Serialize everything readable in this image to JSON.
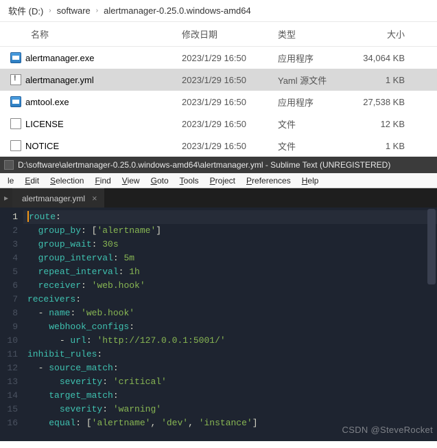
{
  "breadcrumb": [
    "软件 (D:)",
    "software",
    "alertmanager-0.25.0.windows-amd64"
  ],
  "columns": {
    "name": "名称",
    "date": "修改日期",
    "type": "类型",
    "size": "大小"
  },
  "files": [
    {
      "name": "alertmanager.exe",
      "date": "2023/1/29 16:50",
      "type": "应用程序",
      "size": "34,064 KB",
      "icon": "exe",
      "selected": false
    },
    {
      "name": "alertmanager.yml",
      "date": "2023/1/29 16:50",
      "type": "Yaml 源文件",
      "size": "1 KB",
      "icon": "yml",
      "selected": true
    },
    {
      "name": "amtool.exe",
      "date": "2023/1/29 16:50",
      "type": "应用程序",
      "size": "27,538 KB",
      "icon": "exe",
      "selected": false
    },
    {
      "name": "LICENSE",
      "date": "2023/1/29 16:50",
      "type": "文件",
      "size": "12 KB",
      "icon": "file",
      "selected": false
    },
    {
      "name": "NOTICE",
      "date": "2023/1/29 16:50",
      "type": "文件",
      "size": "1 KB",
      "icon": "file",
      "selected": false
    }
  ],
  "sublime": {
    "title": "D:\\software\\alertmanager-0.25.0.windows-amd64\\alertmanager.yml - Sublime Text (UNREGISTERED)",
    "menu": [
      "File",
      "Edit",
      "Selection",
      "Find",
      "View",
      "Goto",
      "Tools",
      "Project",
      "Preferences",
      "Help"
    ],
    "tab": "alertmanager.yml",
    "active_line": 1,
    "code": [
      [
        [
          "key",
          "route"
        ],
        [
          "punc",
          ":"
        ]
      ],
      [
        [
          "indent",
          "  "
        ],
        [
          "key",
          "group_by"
        ],
        [
          "punc",
          ": ["
        ],
        [
          "str",
          "'alertname'"
        ],
        [
          "punc",
          "]"
        ]
      ],
      [
        [
          "indent",
          "  "
        ],
        [
          "key",
          "group_wait"
        ],
        [
          "punc",
          ": "
        ],
        [
          "str",
          "30s"
        ]
      ],
      [
        [
          "indent",
          "  "
        ],
        [
          "key",
          "group_interval"
        ],
        [
          "punc",
          ": "
        ],
        [
          "str",
          "5m"
        ]
      ],
      [
        [
          "indent",
          "  "
        ],
        [
          "key",
          "repeat_interval"
        ],
        [
          "punc",
          ": "
        ],
        [
          "str",
          "1h"
        ]
      ],
      [
        [
          "indent",
          "  "
        ],
        [
          "key",
          "receiver"
        ],
        [
          "punc",
          ": "
        ],
        [
          "str",
          "'web.hook'"
        ]
      ],
      [
        [
          "key",
          "receivers"
        ],
        [
          "punc",
          ":"
        ]
      ],
      [
        [
          "indent",
          "  "
        ],
        [
          "dash",
          "- "
        ],
        [
          "key",
          "name"
        ],
        [
          "punc",
          ": "
        ],
        [
          "str",
          "'web.hook'"
        ]
      ],
      [
        [
          "indent",
          "    "
        ],
        [
          "key",
          "webhook_configs"
        ],
        [
          "punc",
          ":"
        ]
      ],
      [
        [
          "indent",
          "      "
        ],
        [
          "dash",
          "- "
        ],
        [
          "key",
          "url"
        ],
        [
          "punc",
          ": "
        ],
        [
          "str",
          "'http://127.0.0.1:5001/'"
        ]
      ],
      [
        [
          "key",
          "inhibit_rules"
        ],
        [
          "punc",
          ":"
        ]
      ],
      [
        [
          "indent",
          "  "
        ],
        [
          "dash",
          "- "
        ],
        [
          "key",
          "source_match"
        ],
        [
          "punc",
          ":"
        ]
      ],
      [
        [
          "indent",
          "      "
        ],
        [
          "key",
          "severity"
        ],
        [
          "punc",
          ": "
        ],
        [
          "str",
          "'critical'"
        ]
      ],
      [
        [
          "indent",
          "    "
        ],
        [
          "key",
          "target_match"
        ],
        [
          "punc",
          ":"
        ]
      ],
      [
        [
          "indent",
          "      "
        ],
        [
          "key",
          "severity"
        ],
        [
          "punc",
          ": "
        ],
        [
          "str",
          "'warning'"
        ]
      ],
      [
        [
          "indent",
          "    "
        ],
        [
          "key",
          "equal"
        ],
        [
          "punc",
          ": ["
        ],
        [
          "str",
          "'alertname'"
        ],
        [
          "punc",
          ", "
        ],
        [
          "str",
          "'dev'"
        ],
        [
          "punc",
          ", "
        ],
        [
          "str",
          "'instance'"
        ],
        [
          "punc",
          "]"
        ]
      ]
    ]
  },
  "watermark": "CSDN @SteveRocket"
}
